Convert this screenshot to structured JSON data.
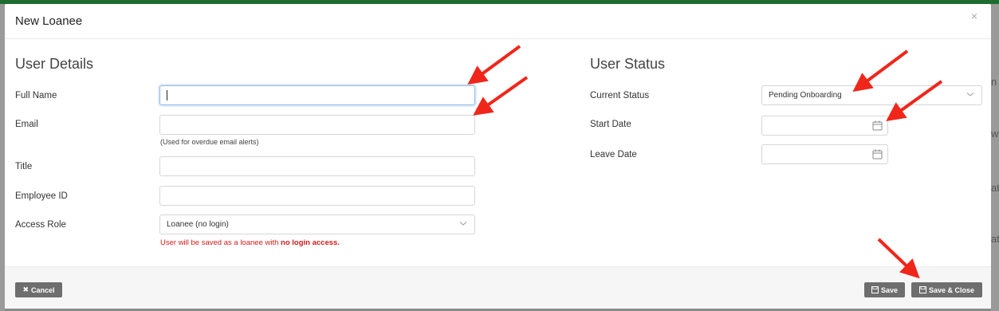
{
  "modal": {
    "title": "New Loanee",
    "close_symbol": "×"
  },
  "user_details": {
    "heading": "User Details",
    "full_name_label": "Full Name",
    "full_name_value": "",
    "email_label": "Email",
    "email_value": "",
    "email_help": "(Used for overdue email alerts)",
    "title_label": "Title",
    "title_value": "",
    "employee_id_label": "Employee ID",
    "employee_id_value": "",
    "access_role_label": "Access Role",
    "access_role_value": "Loanee (no login)",
    "access_warning_prefix": "User will be saved as a loanee with ",
    "access_warning_bold": "no login access."
  },
  "user_status": {
    "heading": "User Status",
    "current_status_label": "Current Status",
    "current_status_value": "Pending Onboarding",
    "start_date_label": "Start Date",
    "start_date_value": "",
    "leave_date_label": "Leave Date",
    "leave_date_value": ""
  },
  "footer": {
    "cancel_label": "Cancel",
    "save_label": "Save",
    "save_close_label": "Save & Close"
  },
  "icons": {
    "close": "close-icon",
    "cancel": "x-icon",
    "save": "floppy-disk-icon",
    "calendar": "calendar-icon",
    "dropdown": "chevron-down-icon",
    "annotation": "red-arrow-icon"
  },
  "colors": {
    "top_bar": "#1f6b30",
    "warning_text": "#d01a1a",
    "button_bg": "#6e6e6e",
    "focus_border": "#8fb7e6",
    "annotation_arrow": "#f0261b"
  },
  "backdrop": {
    "right_edge_letters": [
      "n",
      "wn",
      "at",
      "ate"
    ]
  }
}
